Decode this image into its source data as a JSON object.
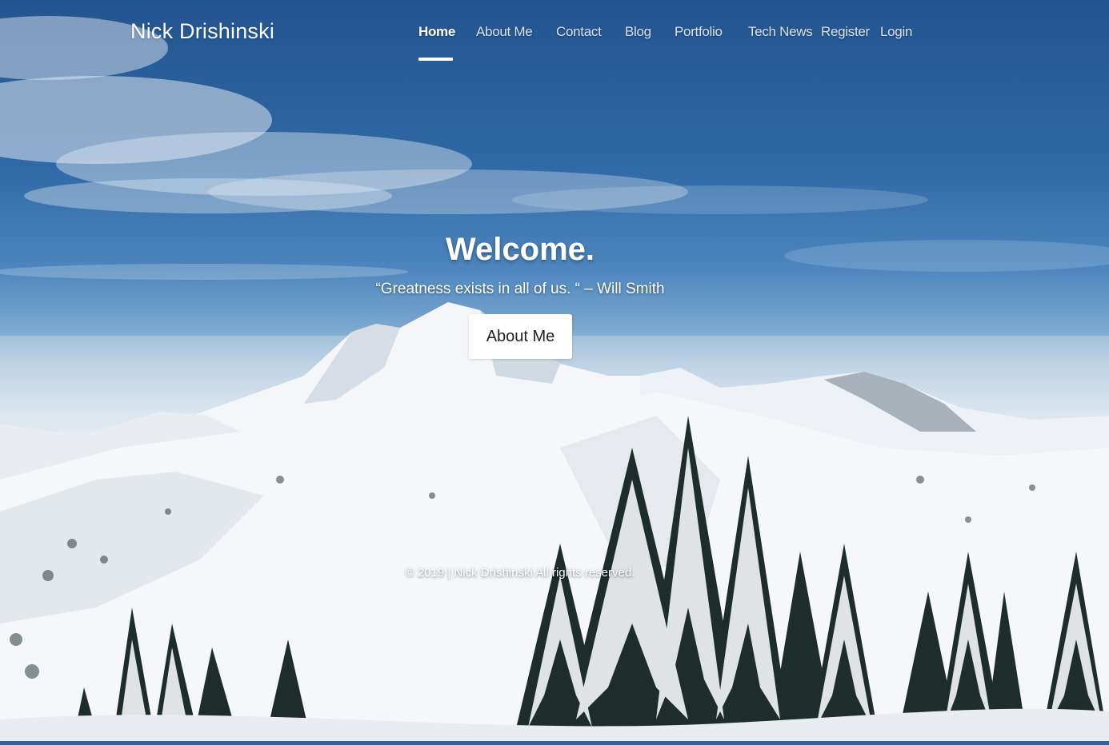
{
  "site": {
    "brand": "Nick Drishinski"
  },
  "nav": {
    "items": [
      {
        "label": "Home",
        "active": true
      },
      {
        "label": "About Me",
        "active": false
      },
      {
        "label": "Contact",
        "active": false
      },
      {
        "label": "Blog",
        "active": false
      },
      {
        "label": "Portfolio",
        "active": false
      },
      {
        "label": "Tech News",
        "active": false
      },
      {
        "label": "Register",
        "active": false
      },
      {
        "label": "Login",
        "active": false
      }
    ]
  },
  "hero": {
    "heading": "Welcome.",
    "quote": "“Greatness exists in all of us. “ – Will Smith",
    "button_label": "About Me",
    "background": "snowy mountain landscape with evergreen trees under blue sky"
  },
  "footer": {
    "prefix": "© 2019 |",
    "owner": "Nick Drishinski",
    "suffix": "All rights reserved."
  },
  "colors": {
    "sky_top": "#24548f",
    "nav_text": "#d9e2ee",
    "button_bg": "#ffffff",
    "bottom_bar": "#3c5f92"
  }
}
